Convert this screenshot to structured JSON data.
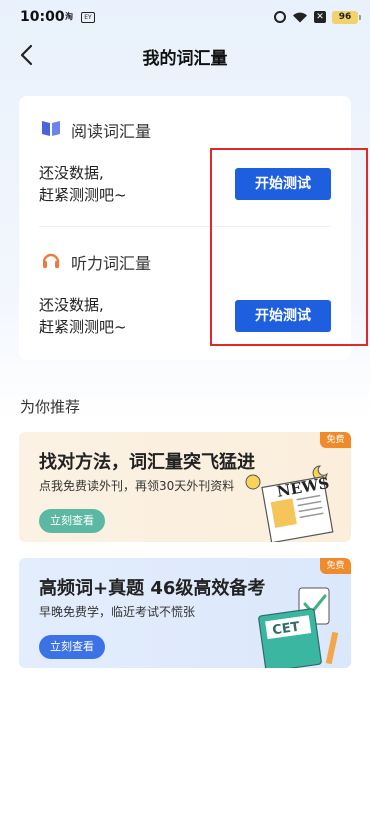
{
  "status_bar": {
    "time": "10:00",
    "app_icon_1": "淘",
    "app_icon_2": "EY",
    "close_glyph": "✕",
    "battery": "96"
  },
  "nav": {
    "title": "我的词汇量"
  },
  "reading_section": {
    "title": "阅读词汇量",
    "status_line1": "还没数据,",
    "status_line2": "赶紧测测吧~",
    "button_label": "开始测试",
    "icon": "book-icon"
  },
  "listening_section": {
    "title": "听力词汇量",
    "status_line1": "还没数据,",
    "status_line2": "赶紧测测吧~",
    "button_label": "开始测试",
    "icon": "headphones-icon"
  },
  "recommend": {
    "heading": "为你推荐",
    "cards": [
      {
        "badge": "免费",
        "title": "找对方法，词汇量突飞猛进",
        "subtitle": "点我免费读外刊，再领30天外刊资料",
        "button_label": "立刻查看",
        "art_text": "NEWS"
      },
      {
        "badge": "免费",
        "title": "高频词+真题 46级高效备考",
        "subtitle": "早晚免费学，临近考试不慌张",
        "button_label": "立刻查看",
        "art_text": "CET"
      }
    ]
  },
  "colors": {
    "primary_button": "#1e5fe0",
    "highlight_border": "#e02a2a",
    "badge": "#f08a2a",
    "book_icon": "#4a63d8",
    "headphones_icon": "#f07a3a"
  }
}
